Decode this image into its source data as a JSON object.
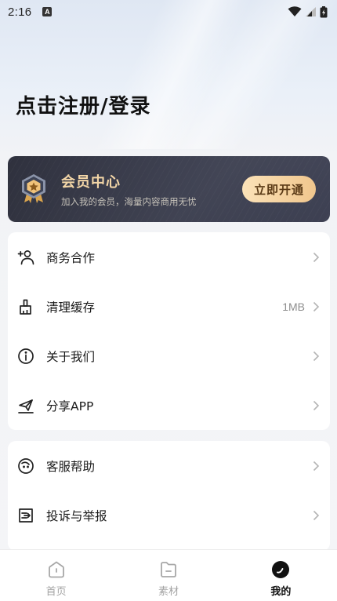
{
  "status_bar": {
    "time": "2:16",
    "badge": "A"
  },
  "header": {
    "title": "点击注册/登录"
  },
  "vip": {
    "title": "会员中心",
    "subtitle": "加入我的会员，海量内容商用无忧",
    "button_label": "立即开通",
    "badge_icon": "vip-badge-icon"
  },
  "menu_group_1": [
    {
      "label": "商务合作",
      "icon": "add-user-icon",
      "value": ""
    },
    {
      "label": "清理缓存",
      "icon": "broom-icon",
      "value": "1MB"
    },
    {
      "label": "关于我们",
      "icon": "info-icon",
      "value": ""
    },
    {
      "label": "分享APP",
      "icon": "share-icon",
      "value": ""
    }
  ],
  "menu_group_2": [
    {
      "label": "客服帮助",
      "icon": "help-icon",
      "value": ""
    },
    {
      "label": "投诉与举报",
      "icon": "report-icon",
      "value": ""
    }
  ],
  "bottom_nav": {
    "items": [
      {
        "label": "首页",
        "icon": "home-icon",
        "active": false
      },
      {
        "label": "素材",
        "icon": "folder-icon",
        "active": false
      },
      {
        "label": "我的",
        "icon": "profile-icon",
        "active": true
      }
    ]
  },
  "colors": {
    "vip_gold": "#f3d6a7",
    "vip_card_bg": "#2b2d3a",
    "text_primary": "#1a1a1a",
    "text_muted": "#a3a3a3"
  }
}
